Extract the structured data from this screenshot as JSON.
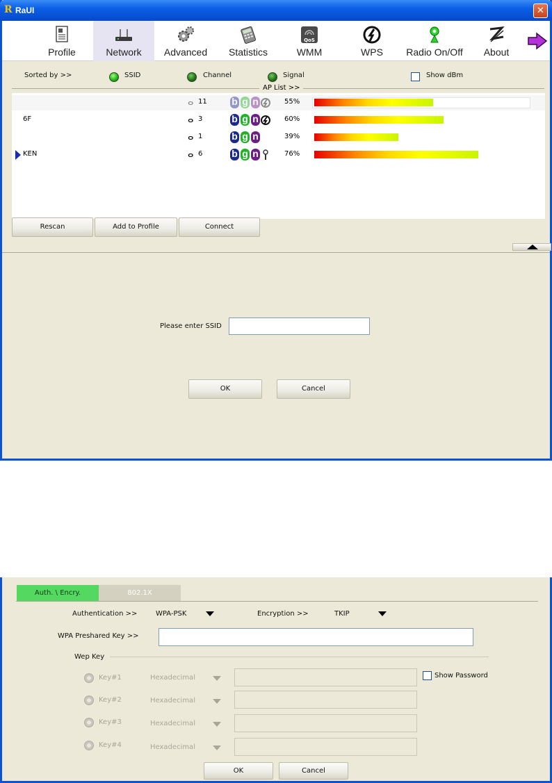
{
  "window": {
    "logo": "R",
    "title": "RaUI",
    "close_icon": "close-icon"
  },
  "toolbar": {
    "items": [
      {
        "label": "Profile",
        "icon": "profile-icon"
      },
      {
        "label": "Network",
        "icon": "network-icon",
        "active": true
      },
      {
        "label": "Advanced",
        "icon": "advanced-icon"
      },
      {
        "label": "Statistics",
        "icon": "statistics-icon"
      },
      {
        "label": "WMM",
        "icon": "wmm-icon"
      },
      {
        "label": "WPS",
        "icon": "wps-icon"
      },
      {
        "label": "Radio On/Off",
        "icon": "radio-icon"
      },
      {
        "label": "About",
        "icon": "about-icon"
      }
    ],
    "more_icon": "arrow-right-icon"
  },
  "sort": {
    "label": "Sorted by >>",
    "ssid": "SSID",
    "channel": "Channel",
    "signal": "Signal",
    "show_dbm": "Show dBm"
  },
  "ap_list": {
    "label": "AP List >>",
    "rows": [
      {
        "ssid": "",
        "channel": "11",
        "protocols": [
          "b",
          "g",
          "n"
        ],
        "wps": true,
        "lock": false,
        "signal_text": "55%",
        "signal": 0.55,
        "faded": true
      },
      {
        "ssid": "6F",
        "channel": "3",
        "protocols": [
          "b",
          "g",
          "n"
        ],
        "wps": true,
        "lock": false,
        "signal_text": "60%",
        "signal": 0.6,
        "faded": false
      },
      {
        "ssid": "",
        "channel": "1",
        "protocols": [
          "b",
          "g",
          "n"
        ],
        "wps": false,
        "lock": false,
        "signal_text": "39%",
        "signal": 0.39,
        "faded": false
      },
      {
        "ssid": "KEN",
        "channel": "6",
        "protocols": [
          "b",
          "g",
          "n"
        ],
        "wps": false,
        "lock": true,
        "signal_text": "76%",
        "signal": 0.76,
        "faded": false,
        "selected": true
      }
    ]
  },
  "buttons": {
    "rescan": "Rescan",
    "add_to_profile": "Add to Profile",
    "connect": "Connect"
  },
  "ssid_dialog": {
    "label": "Please enter SSID",
    "value": "",
    "ok": "OK",
    "cancel": "Cancel"
  },
  "security": {
    "tabs": {
      "auth": "Auth. \\ Encry.",
      "x8021": "802.1X"
    },
    "authentication_label": "Authentication >>",
    "authentication_value": "WPA-PSK",
    "encryption_label": "Encryption >>",
    "encryption_value": "TKIP",
    "psk_label": "WPA Preshared Key >>",
    "psk_value": "",
    "wep_key_label": "Wep Key",
    "keys": [
      {
        "label": "Key#1",
        "format": "Hexadecimal"
      },
      {
        "label": "Key#2",
        "format": "Hexadecimal"
      },
      {
        "label": "Key#3",
        "format": "Hexadecimal"
      },
      {
        "label": "Key#4",
        "format": "Hexadecimal"
      }
    ],
    "show_password": "Show Password",
    "ok": "OK",
    "cancel": "Cancel"
  },
  "colors": {
    "accent": "#0a53d6",
    "active_tab": "#55d860",
    "window_bg": "#ece9d8"
  }
}
